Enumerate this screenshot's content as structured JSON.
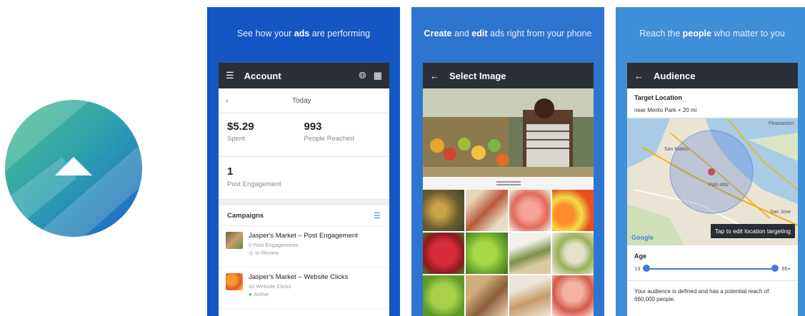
{
  "panel1": {
    "caption_pre": "See how your ",
    "caption_bold": "ads",
    "caption_post": " are performing",
    "appbar_title": "Account",
    "today_label": "Today",
    "spent_value": "$5.29",
    "spent_label": "Spent",
    "reached_value": "993",
    "reached_label": "People Reached",
    "engagement_value": "1",
    "engagement_label": "Post Engagement",
    "campaigns_header": "Campaigns",
    "campaigns": [
      {
        "name": "Jasper's Market – Post Engagement",
        "metric": "0 Post Engagements",
        "status": "In Review"
      },
      {
        "name": "Jasper's Market – Website Clicks",
        "metric": "42 Website Clicks",
        "status": "Active"
      }
    ]
  },
  "panel2": {
    "caption_bold1": "Create",
    "caption_mid": " and ",
    "caption_bold2": "edit",
    "caption_post": " ads right from your phone",
    "appbar_title": "Select Image"
  },
  "panel3": {
    "caption_pre": "Reach the ",
    "caption_bold": "people",
    "caption_post": " who matter to you",
    "appbar_title": "Audience",
    "target_label": "Target Location",
    "location_value": "near Menlo Park + 20 mi",
    "map_labels": {
      "pleasanton": "Pleasanton",
      "san_mateo": "San Mateo",
      "palo_alto": "Palo Alto",
      "san_jose": "San Jose"
    },
    "map_logo": "Google",
    "tooltip": "Tap to edit location targeting",
    "age_label": "Age",
    "age_min": "13",
    "age_max": "65+",
    "reach_text": "Your audience is defined and has a potential reach of 660,000 people."
  },
  "colors": {
    "panel1_bg": "#1457c4",
    "panel2_bg": "#2e75cf",
    "panel3_bg": "#3f8fd6",
    "appbar": "#2b2f36",
    "accent": "#3b7ddd"
  }
}
